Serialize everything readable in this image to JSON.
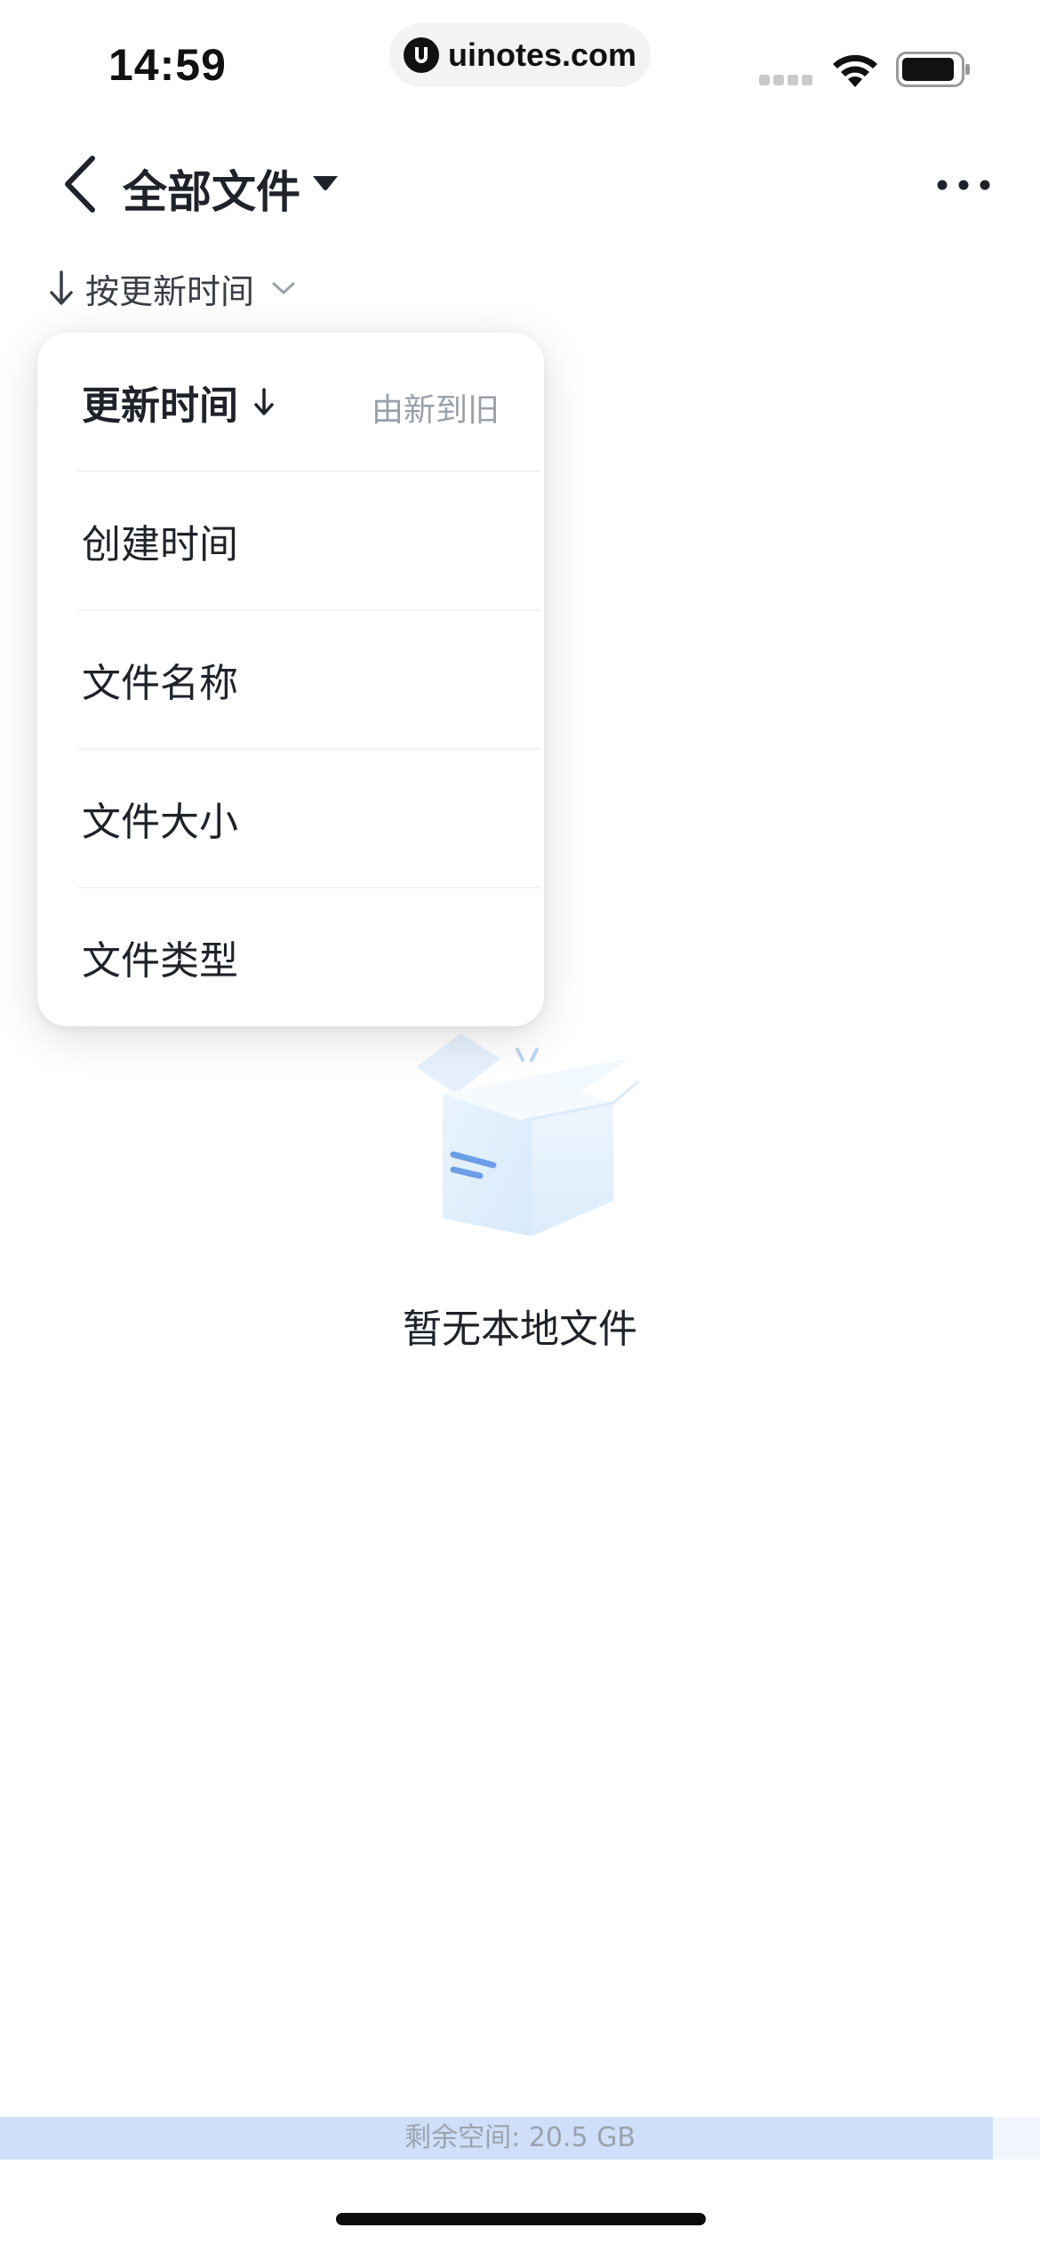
{
  "status_bar": {
    "time": "14:59",
    "url": "uinotes.com"
  },
  "header": {
    "title": "全部文件",
    "back_icon": "chevron-left-icon",
    "caret_icon": "caret-down-icon",
    "more_icon": "more-horizontal-icon"
  },
  "sort": {
    "label": "按更新时间",
    "arrow_icon": "arrow-down-icon",
    "chevron_icon": "chevron-down-icon"
  },
  "dropdown": {
    "items": [
      {
        "label": "更新时间",
        "active": true,
        "order": "由新到旧"
      },
      {
        "label": "创建时间"
      },
      {
        "label": "文件名称"
      },
      {
        "label": "文件大小"
      },
      {
        "label": "文件类型"
      }
    ]
  },
  "empty_state": {
    "message": "暂无本地文件",
    "icon": "empty-box-icon"
  },
  "storage": {
    "label": "剩余空间: 20.5 GB",
    "used_fraction": 0.955
  },
  "colors": {
    "storage_fill": "#cfdff9",
    "storage_track": "#f2f6fc",
    "text_primary": "#1f2329",
    "text_secondary": "#9aa0a8"
  }
}
